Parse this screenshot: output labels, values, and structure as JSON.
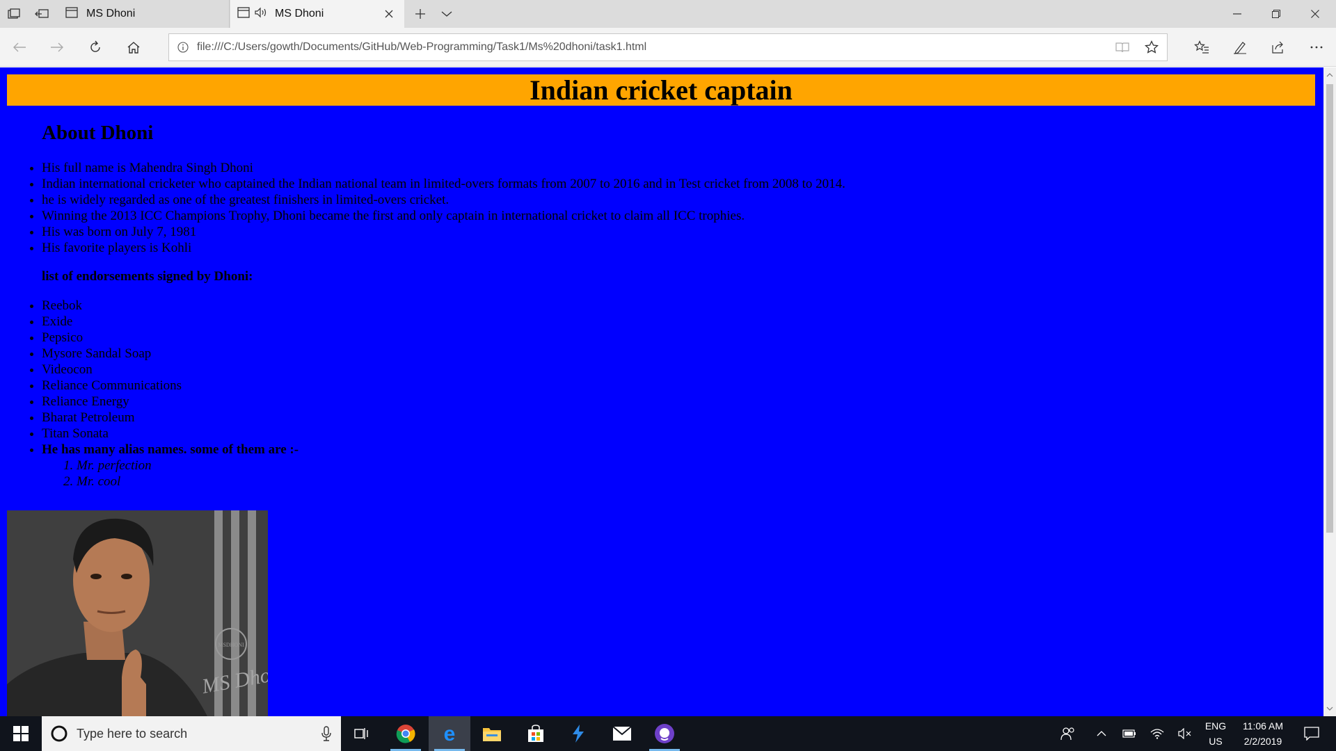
{
  "browser": {
    "tabs": [
      {
        "label": "MS Dhoni",
        "active": false
      },
      {
        "label": "MS Dhoni",
        "active": true,
        "audio": true
      }
    ],
    "address": "file:///C:/Users/gowth/Documents/GitHub/Web-Programming/Task1/Ms%20dhoni/task1.html"
  },
  "page": {
    "banner": "Indian cricket captain",
    "about_heading": "About Dhoni",
    "facts": [
      "His full name is Mahendra Singh Dhoni",
      "Indian international cricketer who captained the Indian national team in limited-overs formats from 2007 to 2016 and in Test cricket from 2008 to 2014.",
      "he is widely regarded as one of the greatest finishers in limited-overs cricket.",
      "Winning the 2013 ICC Champions Trophy, Dhoni became the first and only captain in international cricket to claim all ICC trophies.",
      "His was born on July 7, 1981",
      "His favorite players is Kohli"
    ],
    "endorse_heading": "list of endorsements signed by Dhoni:",
    "endorsements": [
      "Reebok",
      "Exide",
      "Pepsico",
      "Mysore Sandal Soap",
      "Videocon",
      "Reliance Communications",
      "Reliance Energy",
      "Bharat Petroleum",
      "Titan Sonata"
    ],
    "alias_heading": "He has many alias names. some of them are :-",
    "aliases": [
      "Mr. perfection",
      "Mr. cool"
    ],
    "photo_watermark_top": "MSDHONI",
    "photo_watermark_sign": "MS Dhoni"
  },
  "taskbar": {
    "search_placeholder": "Type here to search",
    "lang_top": "ENG",
    "lang_bottom": "US",
    "time": "11:06 AM",
    "date": "2/2/2019"
  },
  "colors": {
    "page_bg": "#0000ff",
    "banner_bg": "#ffa500"
  }
}
